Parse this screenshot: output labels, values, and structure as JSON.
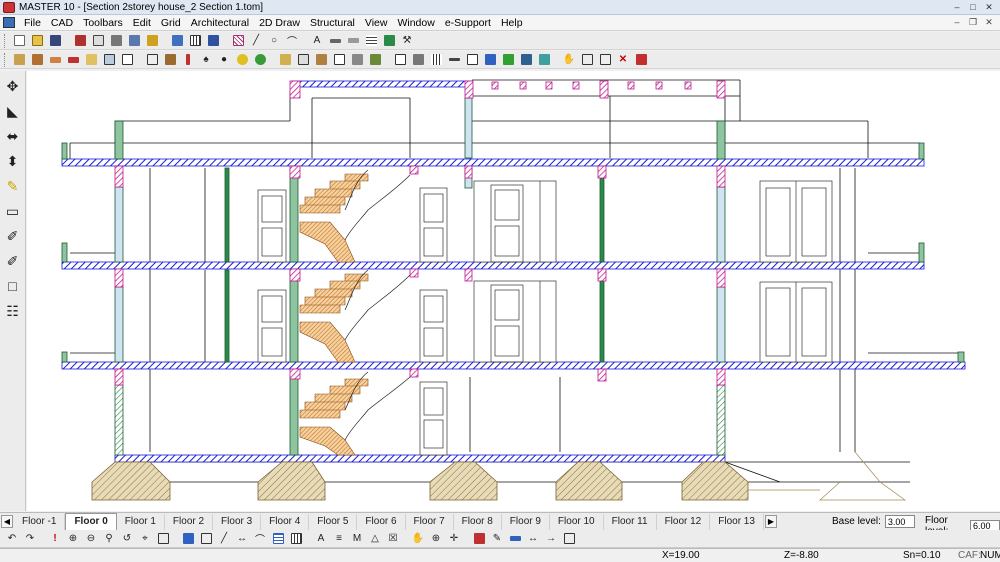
{
  "window": {
    "title": "MASTER 10 - [Section 2storey house_2 Section 1.tom]"
  },
  "menu": [
    "File",
    "CAD",
    "Toolbars",
    "Edit",
    "Grid",
    "Architectural",
    "2D Draw",
    "Structural",
    "View",
    "Window",
    "e-Support",
    "Help"
  ],
  "floor_tabs": [
    "Floor -1",
    "Floor 0",
    "Floor 1",
    "Floor 2",
    "Floor 3",
    "Floor 4",
    "Floor 5",
    "Floor 6",
    "Floor 7",
    "Floor 8",
    "Floor 9",
    "Floor 10",
    "Floor 11",
    "Floor 12",
    "Floor 13"
  ],
  "active_floor_tab": "Floor 0",
  "base_level": {
    "label": "Base level:",
    "value": "3.00"
  },
  "floor_level": {
    "label": "Floor level:",
    "value": "6.00"
  },
  "status": {
    "x": "X=19.00",
    "z": "Z=-8.80",
    "sn": "Sn=0.10",
    "caf": "CAF:",
    "num": "NUM"
  },
  "colors": {
    "slab": "#1a1ad6",
    "column": "#c0148c",
    "wall_green": "#2a8a4a",
    "foundation": "#a08a50",
    "stair": "#d07a20"
  },
  "toolbar1_icons": [
    "new-icon",
    "open-icon",
    "save-icon",
    "print-icon",
    "copy-icon",
    "print-preview-icon",
    "print-setup-icon",
    "export-icon",
    "properties-icon",
    "grid-icon",
    "layers-icon",
    "hatch-icon",
    "line-icon",
    "circle-icon",
    "arc-icon",
    "text-icon",
    "dimension-icon",
    "measure-icon",
    "pattern-icon",
    "brush-icon",
    "tools-icon"
  ],
  "left_tools": [
    "move-view-icon",
    "rotate-view-icon",
    "split-view-icon",
    "section-icon",
    "pencil-icon",
    "eraser-icon",
    "eyedropper-icon",
    "eyedropper-alt-icon",
    "rectangle-icon",
    "layers-stack-icon"
  ]
}
